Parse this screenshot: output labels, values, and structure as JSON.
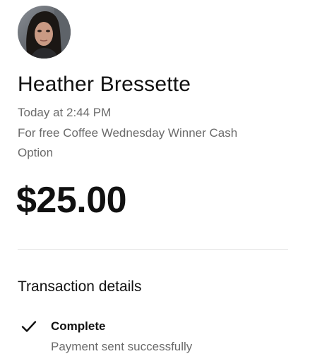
{
  "recipient": {
    "name": "Heather Bressette",
    "avatar_icon": "profile-photo"
  },
  "payment": {
    "time": "Today at 2:44 PM",
    "note_line1": "For free Coffee Wednesday Winner Cash",
    "note_line2": "Option",
    "amount": "$25.00"
  },
  "details": {
    "section_title": "Transaction details",
    "status_icon": "check-icon",
    "status": "Complete",
    "status_subtitle": "Payment sent successfully"
  },
  "colors": {
    "primary_text": "#111111",
    "secondary_text": "#6b6b6b",
    "divider": "#e4e4e4"
  }
}
